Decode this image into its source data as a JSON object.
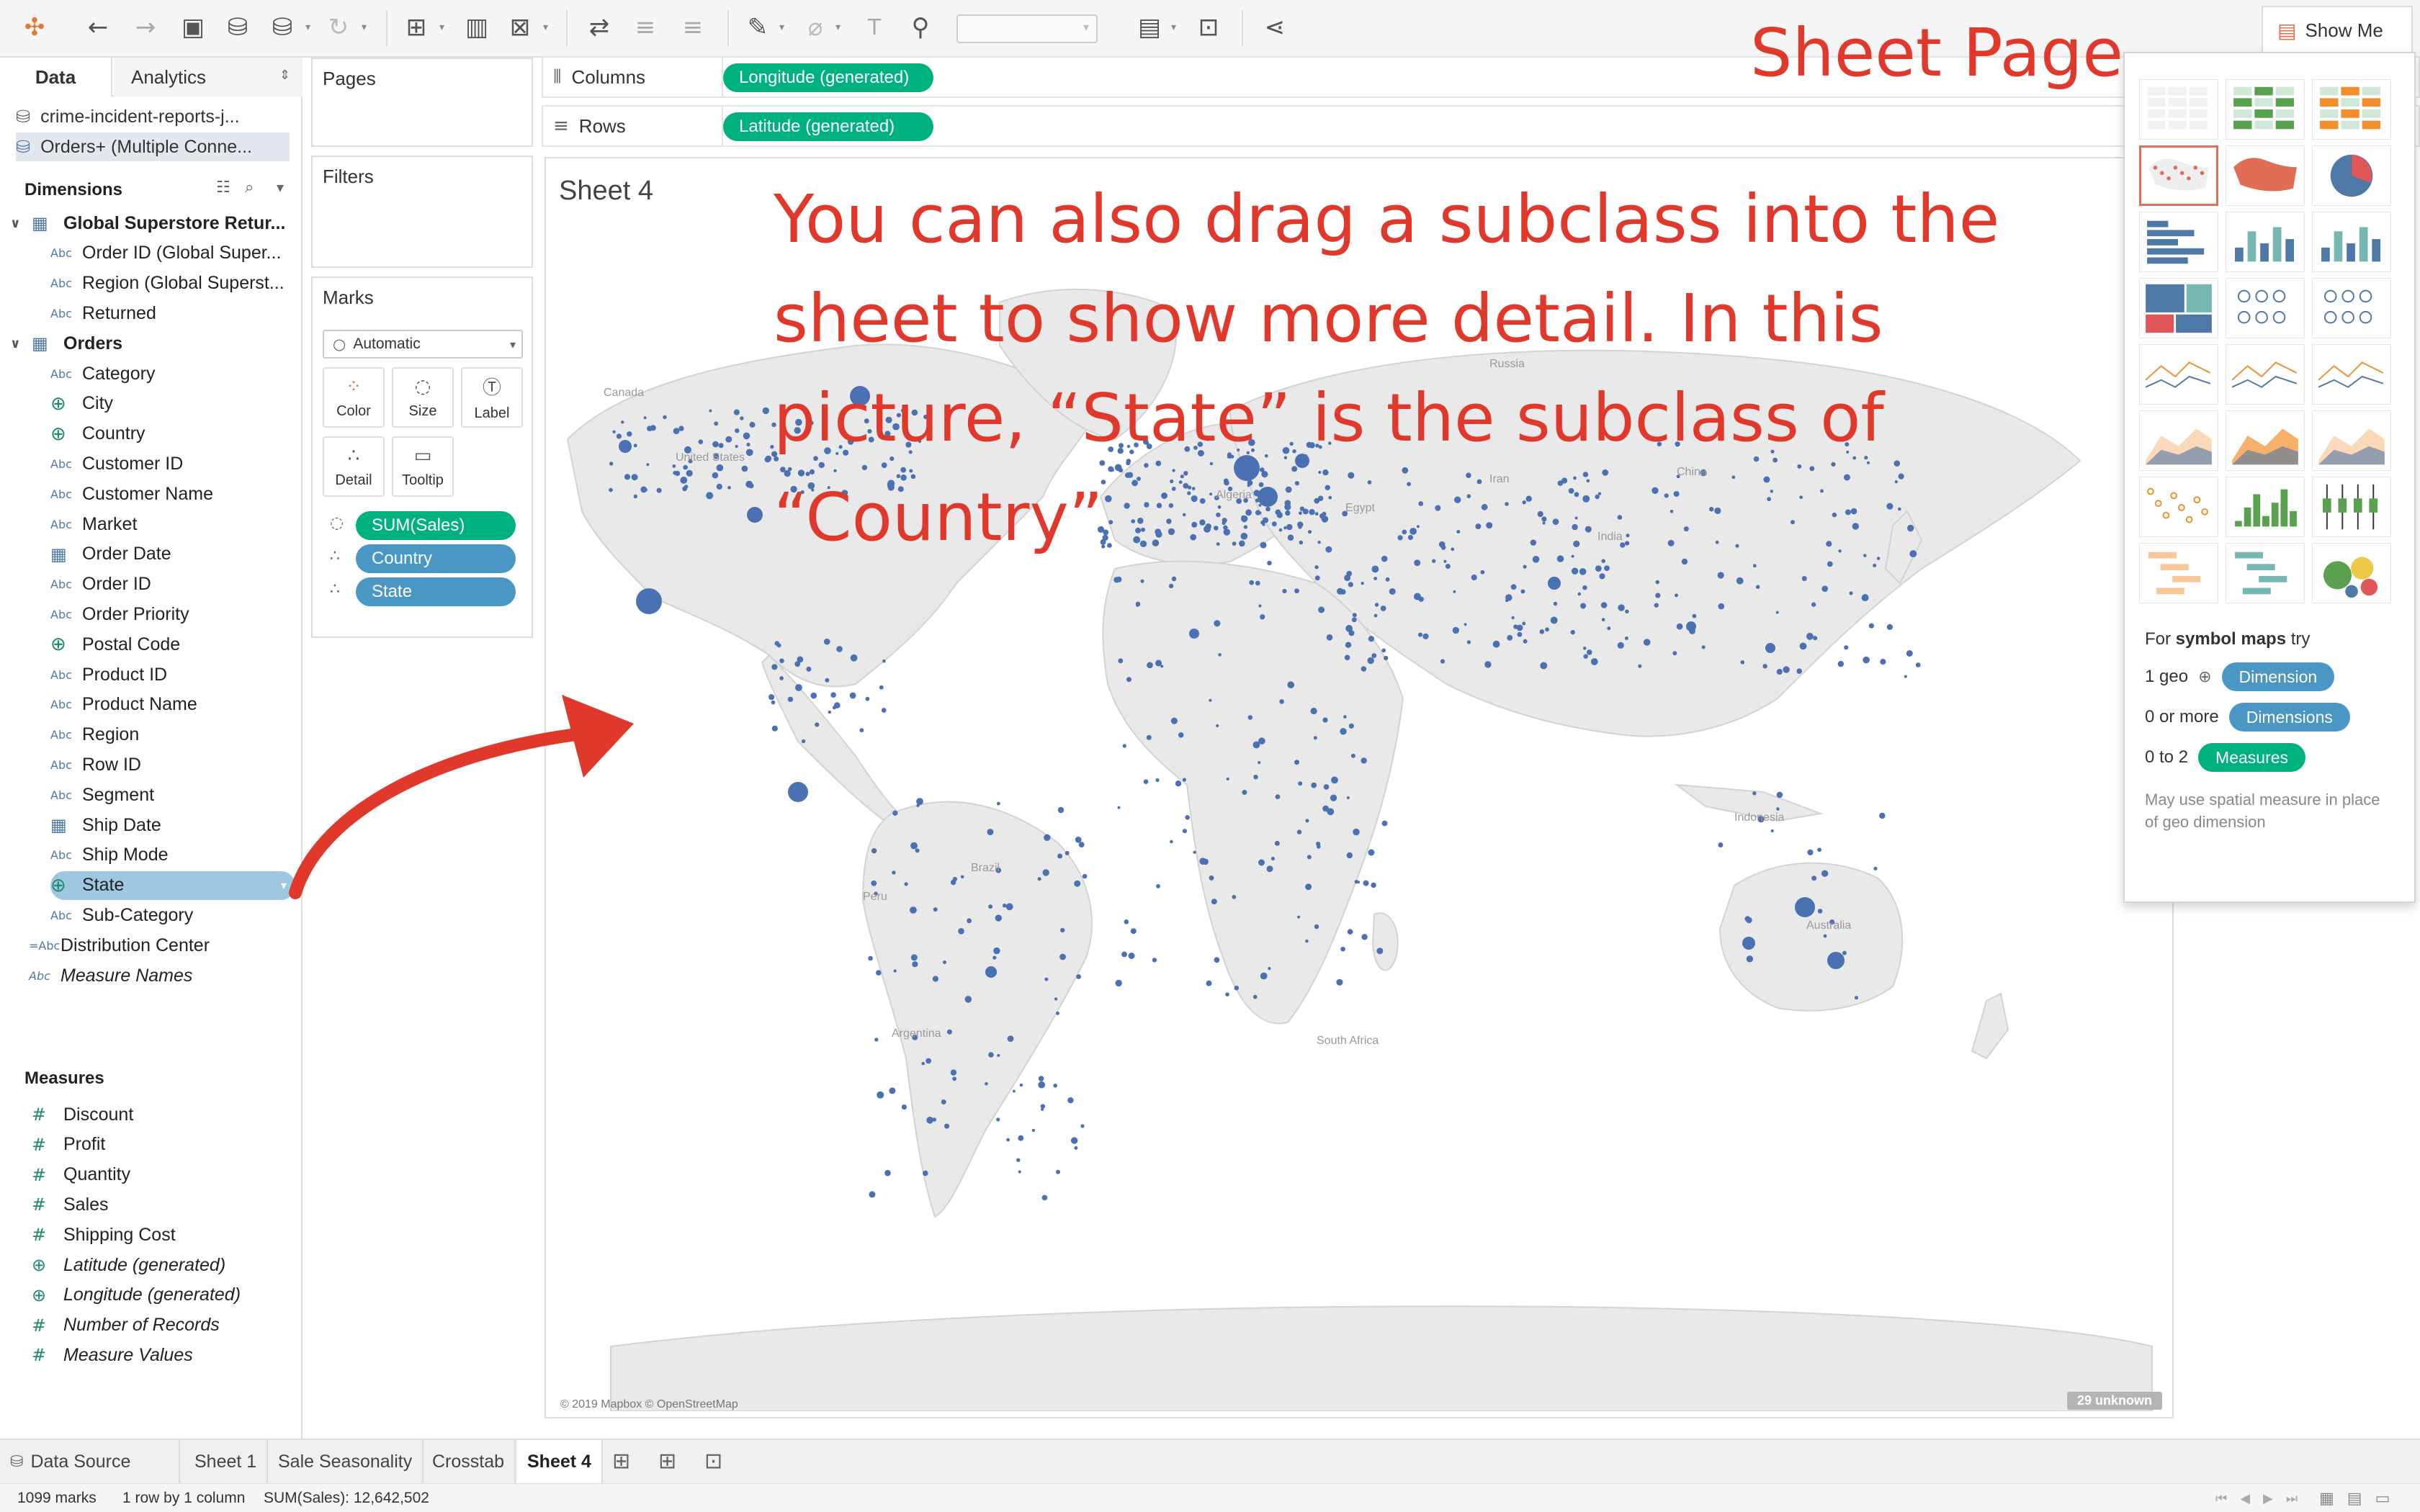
{
  "toolbar": {
    "icons": [
      "tableau-logo-icon",
      "undo-icon",
      "redo-icon",
      "save-icon",
      "new-datasource-icon",
      "pause-updates-icon",
      "refresh-icon",
      "new-worksheet-icon",
      "duplicate-icon",
      "clear-sheet-icon",
      "swap-icon",
      "sort-ascending-icon",
      "sort-descending-icon",
      "highlight-icon",
      "group-icon",
      "label-icon",
      "pin-icon",
      "fit-icon",
      "presentation-icon",
      "share-icon"
    ],
    "show_me_label": "Show Me"
  },
  "data_pane": {
    "tabs": [
      "Data",
      "Analytics"
    ],
    "sources": [
      "crime-incident-reports-j...",
      "Orders+ (Multiple Conne..."
    ],
    "dimensions_header": "Dimensions",
    "groups": [
      {
        "name": "Global Superstore Retur...",
        "fields": [
          "Order ID (Global Super...",
          "Region (Global Superst...",
          "Returned"
        ]
      },
      {
        "name": "Orders",
        "fields": [
          "Category",
          "City",
          "Country",
          "Customer ID",
          "Customer Name",
          "Market",
          "Order Date",
          "Order ID",
          "Order Priority",
          "Postal Code",
          "Product ID",
          "Product Name",
          "Region",
          "Row ID",
          "Segment",
          "Ship Date",
          "Ship Mode",
          "State",
          "Sub-Category"
        ]
      }
    ],
    "extra_dimensions": [
      "Distribution Center",
      "Measure Names"
    ],
    "measures_header": "Measures",
    "measures": [
      "Discount",
      "Profit",
      "Quantity",
      "Sales",
      "Shipping Cost",
      "Latitude (generated)",
      "Longitude (generated)",
      "Number of Records",
      "Measure Values"
    ],
    "type_abc": "Abc",
    "type_abc_calc": "=Abc"
  },
  "cards": {
    "pages": "Pages",
    "filters": "Filters",
    "marks": "Marks",
    "mark_type": "Automatic",
    "mark_buttons": [
      "Color",
      "Size",
      "Label",
      "Detail",
      "Tooltip"
    ],
    "mark_pills": [
      "SUM(Sales)",
      "Country",
      "State"
    ]
  },
  "shelves": {
    "columns_label": "Columns",
    "columns_pill": "Longitude (generated)",
    "rows_label": "Rows",
    "rows_pill": "Latitude (generated)"
  },
  "view": {
    "sheet_title": "Sheet 4",
    "map_credit": "© 2019 Mapbox © OpenStreetMap",
    "unknown_badge": "29 unknown",
    "map_labels": [
      "Canada",
      "United States",
      "Russia",
      "China",
      "Iran",
      "Algeria",
      "Egypt",
      "Brazil",
      "Peru",
      "Argentina",
      "India",
      "Indonesia",
      "Australia",
      "South Africa"
    ]
  },
  "show_me": {
    "hint_prefix": "For ",
    "hint_bold": "symbol maps",
    "hint_suffix": " try",
    "req1_label": "1 geo",
    "req1_pill": "Dimension",
    "req2_label": "0 or more",
    "req2_pill": "Dimensions",
    "req3_label": "0 to 2",
    "req3_pill": "Measures",
    "note": "May use spatial measure in place of geo dimension"
  },
  "annotation": {
    "title": "Sheet Page",
    "body": [
      "You can also drag a subclass into the",
      "sheet to show more detail. In this",
      "picture, “State” is the subclass of",
      "“Country”"
    ],
    "color": "#e0392b"
  },
  "sheet_tabs": [
    "Data Source",
    "Sheet 1",
    "Sale Seasonality",
    "Crosstab",
    "Sheet 4"
  ],
  "active_sheet": "Sheet 4",
  "status": {
    "marks": "1099 marks",
    "dims": "1 row by 1 column",
    "sum": "SUM(Sales): 12,642,502"
  },
  "colors": {
    "dimension_pill": "#4a96c4",
    "measure_pill": "#00b180",
    "mark_dot": "#4a72b2",
    "land": "#e9e9e9"
  }
}
